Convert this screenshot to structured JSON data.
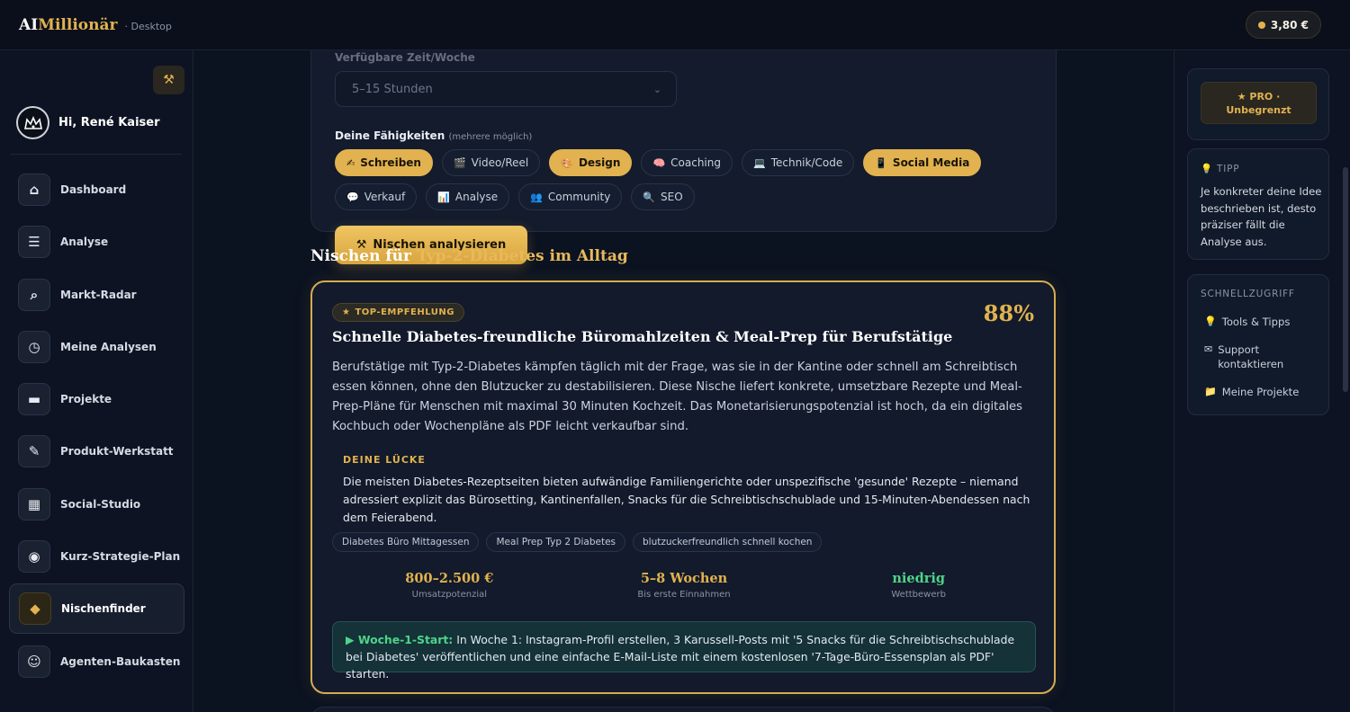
{
  "brand": {
    "name_a": "AI",
    "name_b": "Millionär",
    "platform": "· Desktop"
  },
  "balance": {
    "amount": "3,80 €"
  },
  "user": {
    "greeting": "Hi, René Kaiser"
  },
  "sidebar": {
    "items": [
      {
        "label": "Dashboard",
        "icon": "home-icon"
      },
      {
        "label": "Analyse",
        "icon": "list-icon"
      },
      {
        "label": "Markt-Radar",
        "icon": "radar-search-icon"
      },
      {
        "label": "Meine Analysen",
        "icon": "clock-icon"
      },
      {
        "label": "Projekte",
        "icon": "folder-icon"
      },
      {
        "label": "Produkt-Werkstatt",
        "icon": "tools-icon"
      },
      {
        "label": "Social-Studio",
        "icon": "film-icon"
      },
      {
        "label": "Kurz-Strategie-Plan",
        "icon": "target-icon"
      },
      {
        "label": "Nischenfinder",
        "icon": "niche-icon"
      },
      {
        "label": "Agenten-Baukasten",
        "icon": "robot-icon"
      }
    ],
    "active": "Nischenfinder"
  },
  "form": {
    "time_label": "Verfügbare Zeit/Woche",
    "time_value": "5–15 Stunden",
    "skills_label": "Deine Fähigkeiten",
    "skills_hint": "(mehrere möglich)",
    "skills": [
      {
        "label": "Schreiben",
        "icon": "✍",
        "selected": true
      },
      {
        "label": "Video/Reel",
        "icon": "🎬",
        "selected": false
      },
      {
        "label": "Design",
        "icon": "🎨",
        "selected": true
      },
      {
        "label": "Coaching",
        "icon": "🧠",
        "selected": false
      },
      {
        "label": "Technik/Code",
        "icon": "💻",
        "selected": false
      },
      {
        "label": "Social Media",
        "icon": "📱",
        "selected": true
      },
      {
        "label": "Verkauf",
        "icon": "💬",
        "selected": false
      },
      {
        "label": "Analyse",
        "icon": "📊",
        "selected": false
      },
      {
        "label": "Community",
        "icon": "👥",
        "selected": false
      },
      {
        "label": "SEO",
        "icon": "🔍",
        "selected": false
      }
    ],
    "analyze_button": "Nischen analysieren"
  },
  "results": {
    "heading_prefix": "Nischen für",
    "heading_topic": "Typ-2-Diabetes im Alltag",
    "top": {
      "badge": "TOP-EMPFEHLUNG",
      "score": "88%",
      "title": "Schnelle Diabetes-freundliche Büromahlzeiten & Meal-Prep für Berufstätige",
      "description": "Berufstätige mit Typ-2-Diabetes kämpfen täglich mit der Frage, was sie in der Kantine oder schnell am Schreibtisch essen können, ohne den Blutzucker zu destabilisieren. Diese Nische liefert konkrete, umsetzbare Rezepte und Meal-Prep-Pläne für Menschen mit maximal 30 Minuten Kochzeit. Das Monetarisierungspotenzial ist hoch, da ein digitales Kochbuch oder Wochenpläne als PDF leicht verkaufbar sind.",
      "gap_label": "DEINE LÜCKE",
      "gap_text": "Die meisten Diabetes-Rezeptseiten bieten aufwändige Familiengerichte oder unspezifische 'gesunde' Rezepte – niemand adressiert explizit das Bürosetting, Kantinenfallen, Snacks für die Schreibtischschublade und 15-Minuten-Abendessen nach dem Feierabend.",
      "keywords": [
        "Diabetes Büro Mittagessen",
        "Meal Prep Typ 2 Diabetes",
        "blutzuckerfreundlich schnell kochen"
      ],
      "metrics": [
        {
          "value": "800–2.500 €",
          "label": "Umsatzpotenzial",
          "color": "#e1b24f"
        },
        {
          "value": "5–8 Wochen",
          "label": "Bis erste Einnahmen",
          "color": "#e1b24f"
        },
        {
          "value": "niedrig",
          "label": "Wettbewerb",
          "color": "#4fd48a"
        }
      ],
      "week1_label": "▶ Woche-1-Start:",
      "week1_text": "In Woche 1: Instagram-Profil erstellen, 3 Karussell-Posts mit '5 Snacks für die Schreibtischschublade bei Diabetes' veröffentlichen und eine einfache E-Mail-Liste mit einem kostenlosen '7-Tage-Büro-Essensplan als PDF' starten."
    }
  },
  "right_panel": {
    "pro_line1": "★ PRO ·",
    "pro_line2": "Unbegrenzt",
    "tip_head": "TIPP",
    "tip_text": "Je konkreter deine Idee beschrieben ist, desto präziser fällt die Analyse aus.",
    "quick_head": "SCHNELLZUGRIFF",
    "quick_items": [
      {
        "label": "Tools & Tipps",
        "icon": "💡"
      },
      {
        "label": "Support kontaktieren",
        "icon": "✉"
      },
      {
        "label": "Meine Projekte",
        "icon": "📁"
      }
    ]
  }
}
